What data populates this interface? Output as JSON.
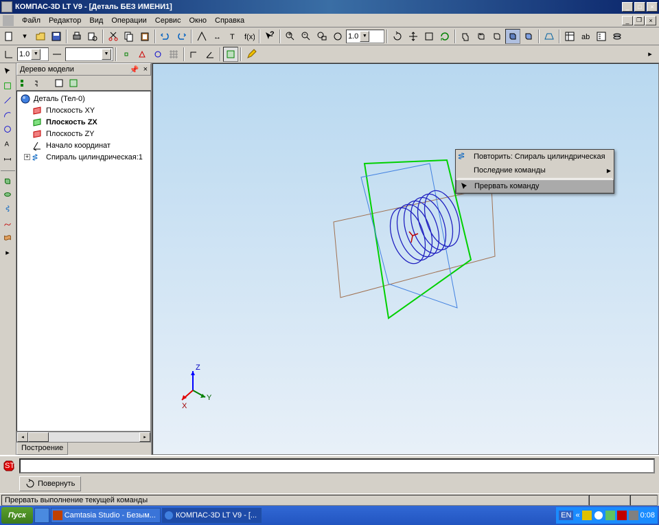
{
  "title": "КОМПАС-3D LT V9 - [Деталь БЕЗ ИМЕНИ1]",
  "menu": {
    "file": "Файл",
    "editor": "Редактор",
    "view": "Вид",
    "ops": "Операции",
    "service": "Сервис",
    "window": "Окно",
    "help": "Справка"
  },
  "combo1": "1.0",
  "combo2": "1.0",
  "tree": {
    "title": "Дерево модели",
    "root": "Деталь (Тел-0)",
    "items": {
      "xy": "Плоскость XY",
      "zx": "Плоскость ZX",
      "zy": "Плоскость ZY",
      "origin": "Начало координат",
      "spiral": "Спираль цилиндрическая:1"
    },
    "tab": "Построение"
  },
  "context": {
    "repeat": "Повторить: Спираль цилиндрическая",
    "recent": "Последние команды",
    "abort": "Прервать команду"
  },
  "bottom_tab": "Повернуть",
  "status": "Прервать выполнение текущей команды",
  "taskbar": {
    "start": "Пуск",
    "task1": "Camtasia Studio - Безым...",
    "task2": "КОМПАС-3D LT V9 - [...",
    "lang": "EN",
    "time": "0:08"
  }
}
